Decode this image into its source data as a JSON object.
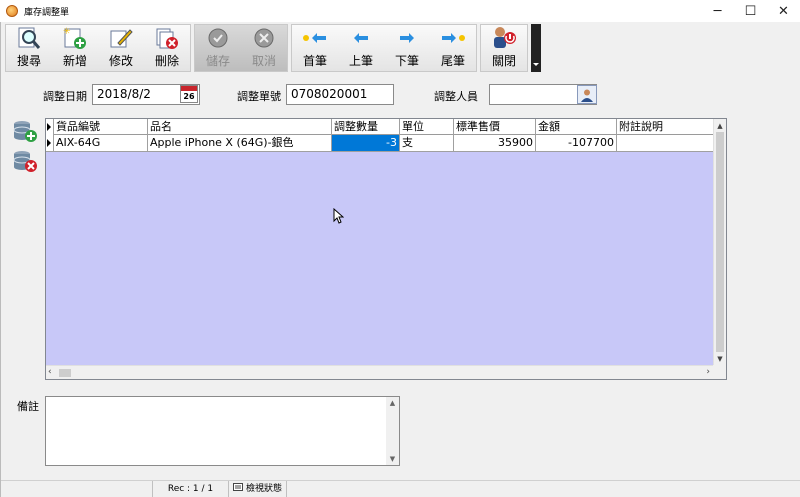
{
  "window": {
    "title": "庫存調整單",
    "controls": {
      "minimize": "─",
      "maximize": "☐",
      "close": "✕"
    }
  },
  "toolbar": {
    "search": "搜尋",
    "add": "新增",
    "edit": "修改",
    "delete": "刪除",
    "save": "儲存",
    "cancel": "取消",
    "first": "首筆",
    "prev": "上筆",
    "next": "下筆",
    "last": "尾筆",
    "close": "關閉"
  },
  "form": {
    "date_label": "調整日期",
    "date_value": "2018/8/2",
    "calendar_day": "26",
    "number_label": "調整單號",
    "number_value": "0708020001",
    "person_label": "調整人員",
    "person_value": ""
  },
  "grid": {
    "headers": [
      "貨品編號",
      "品名",
      "調整數量",
      "單位",
      "標準售價",
      "金額",
      "附註說明"
    ],
    "rows": [
      {
        "code": "AIX-64G",
        "name": "Apple iPhone X (64G)-銀色",
        "qty": "-3",
        "unit": "支",
        "price": "35900",
        "amount": "-107700",
        "note": ""
      }
    ]
  },
  "remark": {
    "label": "備註",
    "value": ""
  },
  "status": {
    "rec": "Rec : 1 / 1",
    "mode": "檢視狀態"
  },
  "colors": {
    "grid_bg": "#c8c8f8",
    "selection": "#0078d7"
  }
}
